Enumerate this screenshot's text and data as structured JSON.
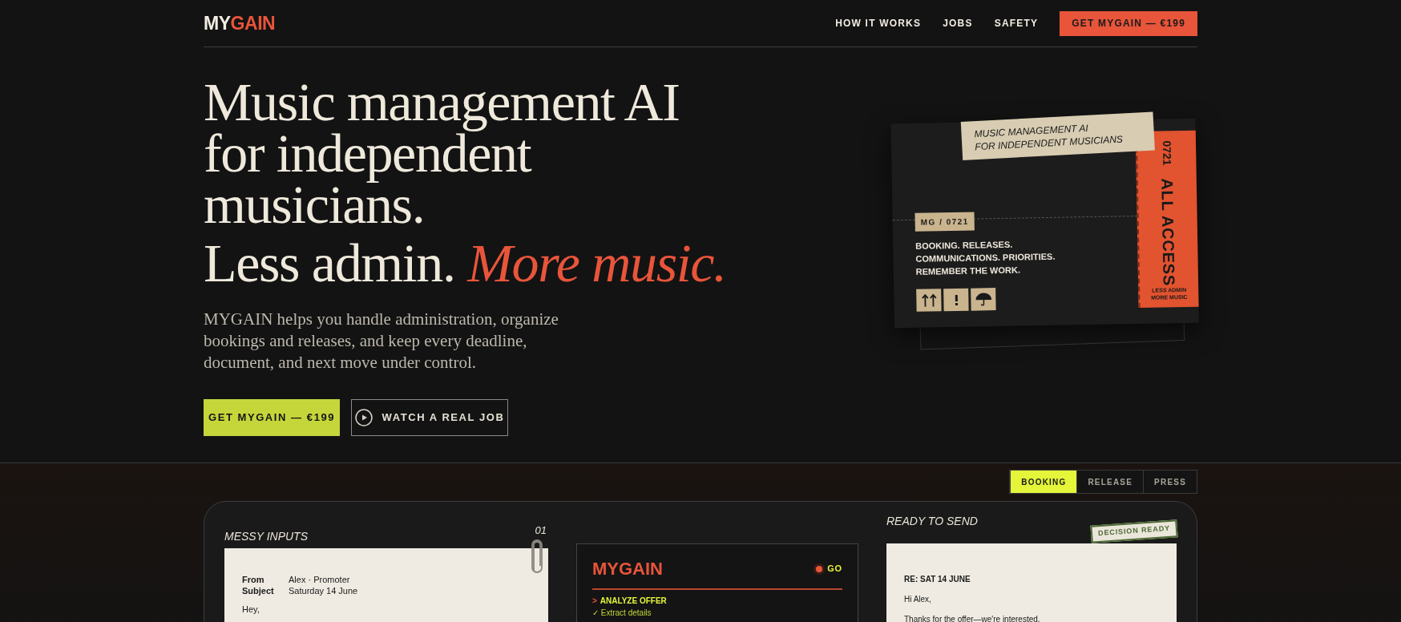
{
  "nav": {
    "logo": {
      "first": "MY",
      "second": "GAIN"
    },
    "links": [
      {
        "label": "HOW IT WORKS"
      },
      {
        "label": "JOBS"
      },
      {
        "label": "SAFETY"
      }
    ],
    "cta": "GET MYGAIN — €199"
  },
  "hero": {
    "title_lines": [
      "Music management AI",
      "for independent",
      "musicians."
    ],
    "tagline": "Less admin. *More music.*",
    "description": "MYGAIN helps you handle administration, organize bookings and releases, and keep every deadline, document, and next move under control.",
    "buttons": [
      {
        "label": "GET MYGAIN — €199",
        "kind": "primary"
      },
      {
        "label": "WATCH A REAL JOB",
        "kind": "video"
      }
    ]
  },
  "ticket": {
    "sticker_lines": [
      "MUSIC MANAGEMENT AI",
      "FOR INDEPENDENT MUSICIANS"
    ],
    "code": "MG / 0721",
    "feature_lines": [
      "BOOKING. RELEASES.",
      "COMMUNICATIONS. PRIORITIES.",
      "REMEMBER THE WORK."
    ],
    "stub": {
      "number": "0721",
      "title": "ALL ACCESS",
      "subtitle_lines": [
        "LESS ADMIN",
        "MORE MUSIC"
      ]
    }
  },
  "demo": {
    "tabs": [
      {
        "label": "BOOKING",
        "selected": true
      },
      {
        "label": "RELEASE",
        "selected": false
      },
      {
        "label": "PRESS",
        "selected": false
      }
    ],
    "inputs": {
      "title": "MESSY INPUTS",
      "number": "01",
      "fields": [
        {
          "label": "From",
          "value": "Alex · Promoter"
        },
        {
          "label": "Subject",
          "value": "Saturday 14 June"
        }
      ],
      "body": "Hey,"
    },
    "engine": {
      "logo": "MYGAIN",
      "status": "GO",
      "step_marker": ">",
      "step": "ANALYZE OFFER",
      "checks": [
        {
          "mark": "✓",
          "text": "Extract details"
        }
      ]
    },
    "output": {
      "title": "READY TO SEND",
      "badge": "DECISION READY",
      "subject": "RE: SAT 14 JUNE",
      "lines": [
        "Hi Alex,",
        "Thanks for the offer—we're interested."
      ]
    }
  }
}
